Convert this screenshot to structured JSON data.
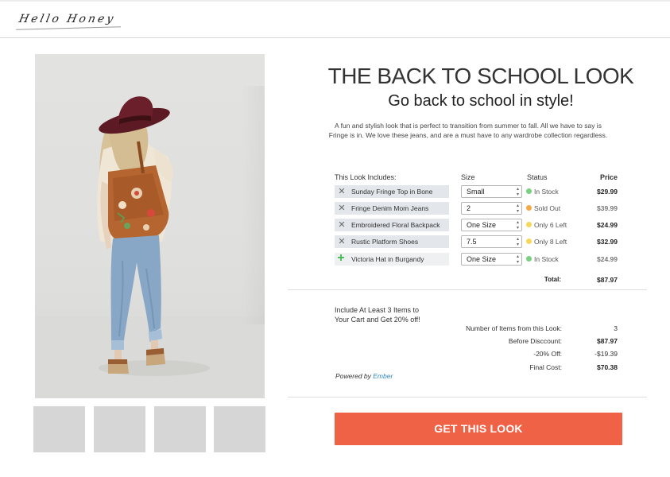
{
  "brand": {
    "logo_text": "Hello Honey"
  },
  "look": {
    "title": "THE BACK TO SCHOOL LOOK",
    "subtitle": "Go back to school in style!",
    "description": "A fun and stylish look that is perfect to transition from summer to fall. All we have to say is Fringe is in. We love these jeans, and are a must have to any wardrobe collection regardless."
  },
  "table": {
    "headers": {
      "items": "This Look Includes:",
      "size": "Size",
      "status": "Status",
      "price": "Price"
    },
    "items": [
      {
        "name": "Sunday Fringe Top in Bone",
        "action": "remove",
        "size": "Small",
        "status": "In Stock",
        "status_color": "#7bd07f",
        "price": "$29.99",
        "in_cart": true
      },
      {
        "name": "Fringe Denim Mom Jeans",
        "action": "remove",
        "size": "2",
        "status": "Sold Out",
        "status_color": "#f4a949",
        "price": "$39.99",
        "in_cart": false
      },
      {
        "name": "Embroidered Floral Backpack",
        "action": "remove",
        "size": "One Size",
        "status": "Only 6 Left",
        "status_color": "#f5d85a",
        "price": "$24.99",
        "in_cart": true
      },
      {
        "name": "Rustic Platform Shoes",
        "action": "remove",
        "size": "7.5",
        "status": "Only 8 Left",
        "status_color": "#f5d85a",
        "price": "$32.99",
        "in_cart": true
      },
      {
        "name": "Victoria Hat in Burgandy",
        "action": "add",
        "size": "One Size",
        "status": "In Stock",
        "status_color": "#7bd07f",
        "price": "$24.99",
        "in_cart": false
      }
    ],
    "total_label": "Total:",
    "total_value": "$87.97"
  },
  "promo": {
    "line1": "Include At Least 3 Items to",
    "line2": "Your Cart and Get 20% off!"
  },
  "summary": [
    {
      "label": "Number of Items from this Look:",
      "value": "3",
      "bold": false
    },
    {
      "label": "Before Disccount:",
      "value": "$87.97",
      "bold": true
    },
    {
      "label": "-20% Off:",
      "value": "-$19.39",
      "bold": false
    },
    {
      "label": "Final Cost:",
      "value": "$70.38",
      "bold": true
    }
  ],
  "powered": {
    "prefix": "Powered by",
    "link": "Ember"
  },
  "cta": {
    "label": "GET THIS LOOK",
    "color": "#ef6246"
  },
  "thumbnails": {
    "count": 4
  }
}
